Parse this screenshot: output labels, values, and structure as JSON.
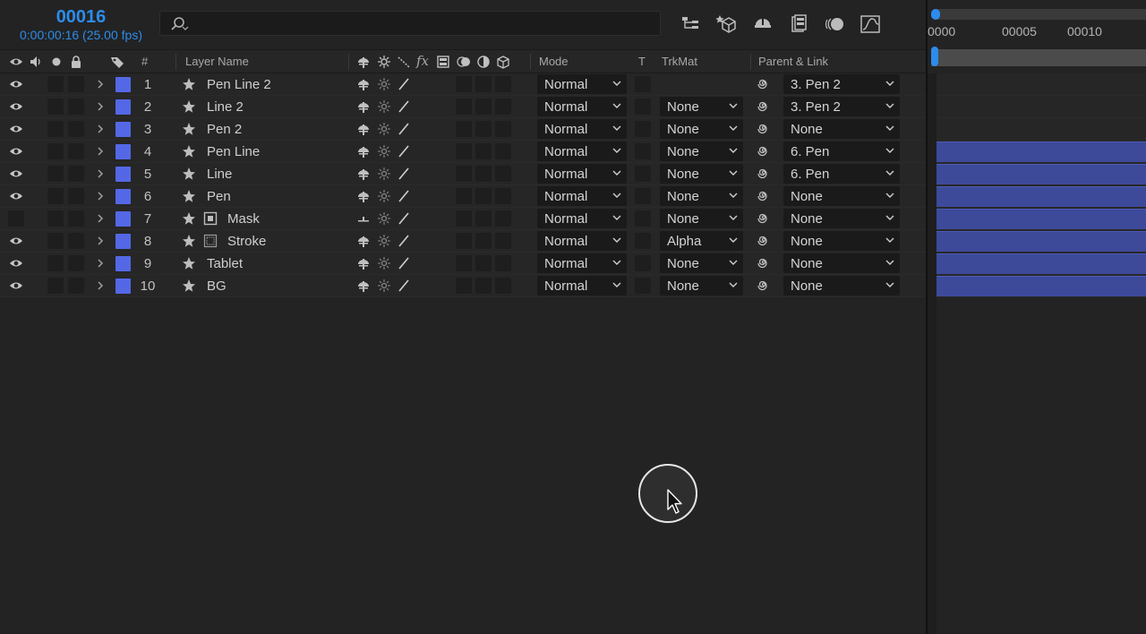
{
  "timecode": {
    "frame": "00016",
    "detail": "0:00:00:16 (25.00 fps)"
  },
  "search": {
    "placeholder": ""
  },
  "header": {
    "num": "#",
    "layer_name": "Layer Name",
    "fx": "fx",
    "mode": "Mode",
    "t": "T",
    "trkmat": "TrkMat",
    "parent": "Parent & Link"
  },
  "layers": [
    {
      "index": "1",
      "name": "Pen Line 2",
      "mode": "Normal",
      "trkmat": "",
      "parent": "3. Pen 2",
      "visible": true
    },
    {
      "index": "2",
      "name": "Line 2",
      "mode": "Normal",
      "trkmat": "None",
      "parent": "3. Pen 2",
      "visible": true
    },
    {
      "index": "3",
      "name": "Pen 2",
      "mode": "Normal",
      "trkmat": "None",
      "parent": "None",
      "visible": true
    },
    {
      "index": "4",
      "name": "Pen Line",
      "mode": "Normal",
      "trkmat": "None",
      "parent": "6. Pen",
      "visible": true
    },
    {
      "index": "5",
      "name": "Line",
      "mode": "Normal",
      "trkmat": "None",
      "parent": "6. Pen",
      "visible": true
    },
    {
      "index": "6",
      "name": "Pen",
      "mode": "Normal",
      "trkmat": "None",
      "parent": "None",
      "visible": true
    },
    {
      "index": "7",
      "name": "Mask",
      "mode": "Normal",
      "trkmat": "None",
      "parent": "None",
      "visible": false,
      "type_icon": "solid-icon"
    },
    {
      "index": "8",
      "name": "Stroke",
      "mode": "Normal",
      "trkmat": "Alpha",
      "parent": "None",
      "visible": true,
      "type_icon": "precomp-icon"
    },
    {
      "index": "9",
      "name": "Tablet",
      "mode": "Normal",
      "trkmat": "None",
      "parent": "None",
      "visible": true
    },
    {
      "index": "10",
      "name": "BG",
      "mode": "Normal",
      "trkmat": "None",
      "parent": "None",
      "visible": true
    }
  ],
  "timeline": {
    "ruler_labels": [
      "0000",
      "00005",
      "00010"
    ],
    "layer_bars_visible": [
      false,
      false,
      false,
      true,
      true,
      true,
      true,
      true,
      true,
      true
    ]
  },
  "colors": {
    "accent": "#2d8ceb",
    "label": "#5468e6",
    "bar": "#3d4a9a"
  }
}
